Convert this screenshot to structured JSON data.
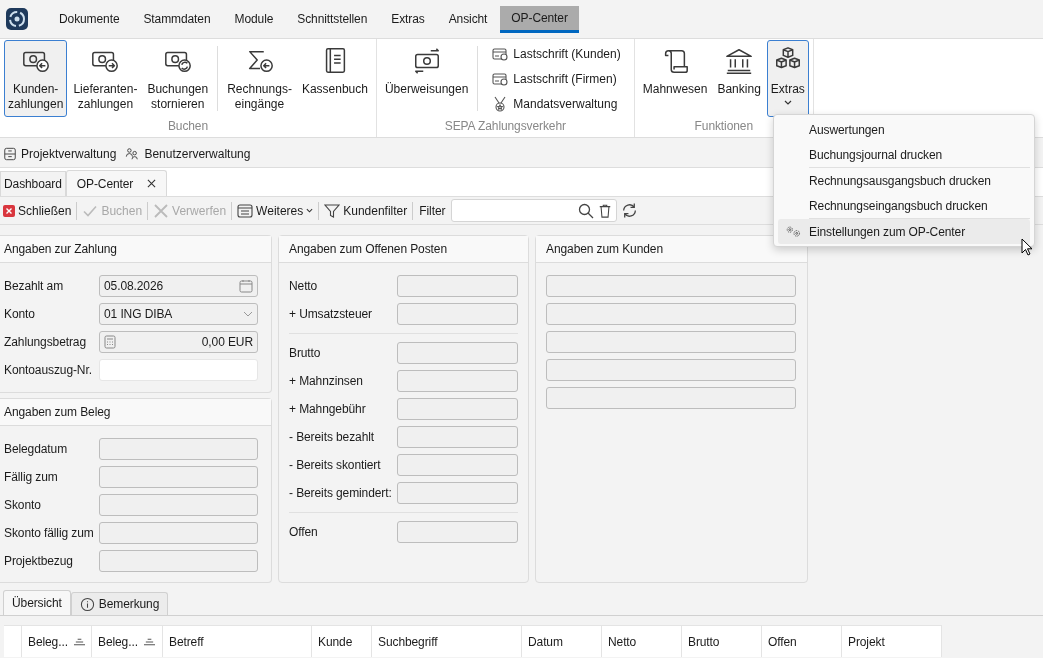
{
  "menubar": {
    "items": [
      {
        "label": "Dokumente",
        "selected": false
      },
      {
        "label": "Stammdaten",
        "selected": false
      },
      {
        "label": "Module",
        "selected": false
      },
      {
        "label": "Schnittstellen",
        "selected": false
      },
      {
        "label": "Extras",
        "selected": false
      },
      {
        "label": "Ansicht",
        "selected": false
      },
      {
        "label": "OP-Center",
        "selected": true
      }
    ]
  },
  "ribbon": {
    "groups": [
      {
        "title": "Buchen",
        "sections": [
          [
            {
              "label": "Kunden-\nzahlungen",
              "kind": "large",
              "selected": true,
              "has_menu": false
            },
            {
              "label": "Lieferanten-\nzahlungen",
              "kind": "large",
              "selected": false,
              "has_menu": false
            },
            {
              "label": "Buchungen\nstornieren",
              "kind": "large",
              "selected": false,
              "has_menu": false
            }
          ],
          [
            {
              "label": "Rechnungs-\neingänge",
              "kind": "large",
              "selected": false,
              "has_menu": false
            },
            {
              "label": "Kassenbuch",
              "kind": "large",
              "selected": false,
              "has_menu": false
            }
          ]
        ]
      },
      {
        "title": "SEPA Zahlungsverkehr",
        "sections": [
          [
            {
              "label": "Überweisungen",
              "kind": "large",
              "selected": false,
              "has_menu": false
            }
          ],
          [
            {
              "label": "Lastschrift (Kunden)",
              "kind": "small"
            },
            {
              "label": "Lastschrift (Firmen)",
              "kind": "small"
            },
            {
              "label": "Mandatsverwaltung",
              "kind": "small"
            }
          ]
        ]
      },
      {
        "title": "Funktionen",
        "sections": [
          [
            {
              "label": "Mahnwesen",
              "kind": "large",
              "selected": false,
              "has_menu": false
            },
            {
              "label": "Banking",
              "kind": "large",
              "selected": false,
              "has_menu": false
            },
            {
              "label": "Extras",
              "kind": "large",
              "selected": true,
              "has_menu": true
            }
          ]
        ]
      }
    ]
  },
  "extras_menu": {
    "items": [
      {
        "label": "Auswertungen",
        "separator_before": false,
        "has_icon": false,
        "selected": false
      },
      {
        "label": "Buchungsjournal drucken",
        "separator_before": false,
        "has_icon": false,
        "selected": false
      },
      {
        "label": "Rechnungsausgangsbuch drucken",
        "separator_before": true,
        "has_icon": false,
        "selected": false
      },
      {
        "label": "Rechnungseingangsbuch drucken",
        "separator_before": false,
        "has_icon": false,
        "selected": false
      },
      {
        "label": "Einstellungen zum OP-Center",
        "separator_before": true,
        "has_icon": true,
        "selected": true
      }
    ]
  },
  "quickbar": {
    "items": [
      "Projektverwaltung",
      "Benutzerverwaltung"
    ]
  },
  "doc_tabs": [
    {
      "label": "Dashboard",
      "selected": false,
      "closable": false
    },
    {
      "label": "OP-Center",
      "selected": true,
      "closable": true
    }
  ],
  "toolbar": {
    "items": [
      {
        "label": "Schließen",
        "disabled": false,
        "has_menu": false
      },
      {
        "label": "Buchen",
        "disabled": true,
        "has_menu": false
      },
      {
        "label": "Verwerfen",
        "disabled": true,
        "has_menu": false
      },
      {
        "label": "Weiteres",
        "disabled": false,
        "has_menu": true
      },
      {
        "label": "Kundenfilter",
        "disabled": false,
        "has_menu": false
      }
    ],
    "filter": {
      "label": "Filter"
    }
  },
  "panels": {
    "zahlung": {
      "title": "Angaben zur Zahlung",
      "rows": [
        {
          "label": "Bezahlt am",
          "value": "05.08.2026",
          "kind": "date",
          "editable": false
        },
        {
          "label": "Konto",
          "value": "01 ING DIBA",
          "kind": "select",
          "editable": false
        },
        {
          "label": "Zahlungsbetrag",
          "value": "0,00 EUR",
          "kind": "amount",
          "editable": false
        },
        {
          "label": "Kontoauszug-Nr.",
          "kind": "text",
          "editable": true
        }
      ]
    },
    "beleg": {
      "title": "Angaben zum Beleg",
      "rows": [
        {
          "label": "Belegdatum",
          "editable": false
        },
        {
          "label": "Fällig zum",
          "editable": false
        },
        {
          "label": "Skonto",
          "editable": false
        },
        {
          "label": "Skonto fällig zum",
          "editable": false
        },
        {
          "label": "Projektbezug",
          "editable": false
        }
      ]
    },
    "offener_posten": {
      "title": "Angaben zum Offenen Posten",
      "sections": [
        [
          {
            "label": "Netto",
            "editable": false
          },
          {
            "label": "+ Umsatzsteuer",
            "editable": false
          }
        ],
        [
          {
            "label": "Brutto",
            "editable": false
          },
          {
            "label": "+ Mahnzinsen",
            "editable": false
          },
          {
            "label": "+ Mahngebühr",
            "editable": false
          },
          {
            "label": "- Bereits bezahlt",
            "editable": false
          },
          {
            "label": "- Bereits skontiert",
            "editable": false
          },
          {
            "label": "- Bereits gemindert:",
            "editable": false
          }
        ],
        [
          {
            "label": "Offen",
            "editable": false
          }
        ]
      ]
    },
    "kunde": {
      "title": "Angaben zum Kunden",
      "fields": [
        {
          "editable": false
        },
        {
          "editable": false
        },
        {
          "editable": false
        },
        {
          "editable": false
        },
        {
          "editable": false
        }
      ]
    }
  },
  "bottom_tabs": [
    {
      "label": "Übersicht",
      "selected": true,
      "has_icon": false
    },
    {
      "label": "Bemerkung",
      "selected": false,
      "has_icon": true
    }
  ],
  "table": {
    "columns": [
      {
        "label": "Beleg...",
        "sortable": true
      },
      {
        "label": "Beleg...",
        "sortable": true
      },
      {
        "label": "Betreff",
        "sortable": false
      },
      {
        "label": "Kunde",
        "sortable": false
      },
      {
        "label": "Suchbegriff",
        "sortable": false
      },
      {
        "label": "Datum",
        "sortable": false
      },
      {
        "label": "Netto",
        "sortable": false
      },
      {
        "label": "Brutto",
        "sortable": false
      },
      {
        "label": "Offen",
        "sortable": false
      },
      {
        "label": "Projekt",
        "sortable": false
      }
    ]
  }
}
